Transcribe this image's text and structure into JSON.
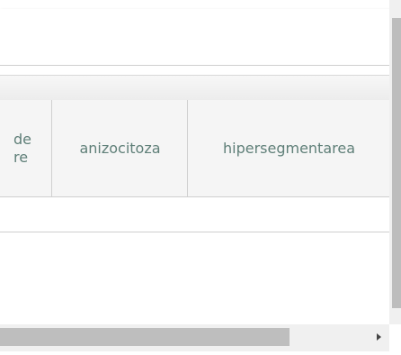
{
  "table": {
    "header_cells": [
      {
        "label_line1": "de",
        "label_line2": "re"
      },
      {
        "label": "anizocitoza"
      },
      {
        "label": "hipersegmentarea"
      }
    ]
  },
  "icons": {
    "scroll_right": "scroll-right-arrow-icon"
  }
}
